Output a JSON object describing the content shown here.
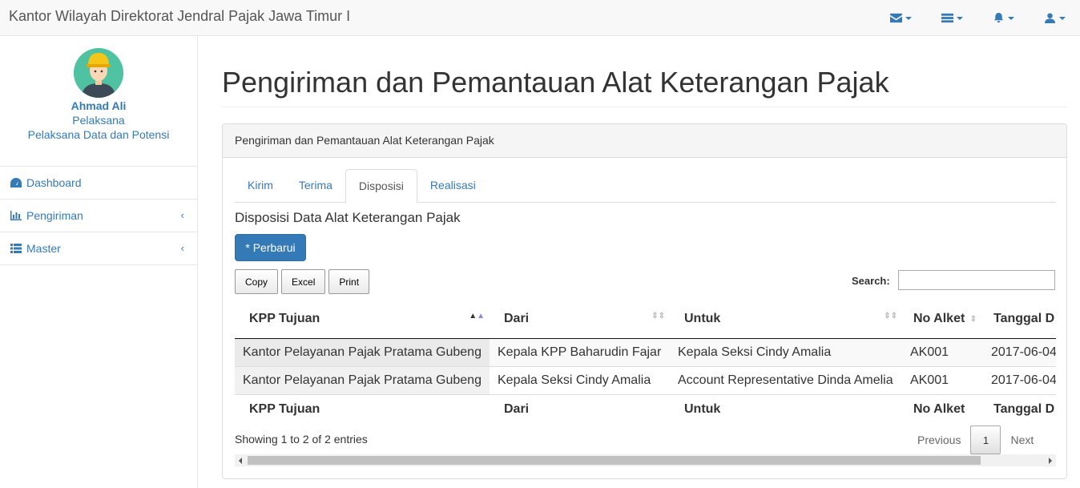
{
  "app": {
    "brand": "Kantor Wilayah Direktorat Jendral Pajak Jawa Timur I",
    "accent_color": "#337ab7",
    "nav_icons": [
      "envelope-icon",
      "tasks-icon",
      "bell-icon",
      "user-icon"
    ]
  },
  "profile": {
    "name": "Ahmad Ali",
    "role": "Pelaksana",
    "unit": "Pelaksana Data dan Potensi"
  },
  "sidebar": {
    "items": [
      {
        "label": "Dashboard",
        "icon": "dashboard-icon"
      },
      {
        "label": "Pengiriman",
        "icon": "bar-chart-icon",
        "chevron": "‹"
      },
      {
        "label": "Master",
        "icon": "list-icon",
        "chevron": "‹"
      }
    ]
  },
  "page": {
    "title": "Pengiriman dan Pemantauan Alat Keterangan Pajak",
    "panel_heading": "Pengiriman dan Pemantauan Alat Keterangan Pajak",
    "tabs": [
      "Kirim",
      "Terima",
      "Disposisi",
      "Realisasi"
    ],
    "active_tab": "Disposisi",
    "section_title": "Disposisi Data Alat Keterangan Pajak",
    "refresh_button": "* Perbarui",
    "export_buttons": [
      "Copy",
      "Excel",
      "Print"
    ],
    "search_label": "Search:",
    "search_value": ""
  },
  "table": {
    "columns": [
      "KPP Tujuan",
      "Dari",
      "Untuk",
      "No Alket",
      "Tanggal D"
    ],
    "rows": [
      [
        "Kantor Pelayanan Pajak Pratama Gubeng",
        "Kepala KPP Baharudin Fajar",
        "Kepala Seksi Cindy Amalia",
        "AK001",
        "2017-06-04"
      ],
      [
        "Kantor Pelayanan Pajak Pratama Gubeng",
        "Kepala Seksi Cindy Amalia",
        "Account Representative Dinda Amelia",
        "AK001",
        "2017-06-04"
      ]
    ],
    "info": "Showing 1 to 2 of 2 entries",
    "pagination": {
      "previous": "Previous",
      "current": "1",
      "next": "Next"
    }
  }
}
